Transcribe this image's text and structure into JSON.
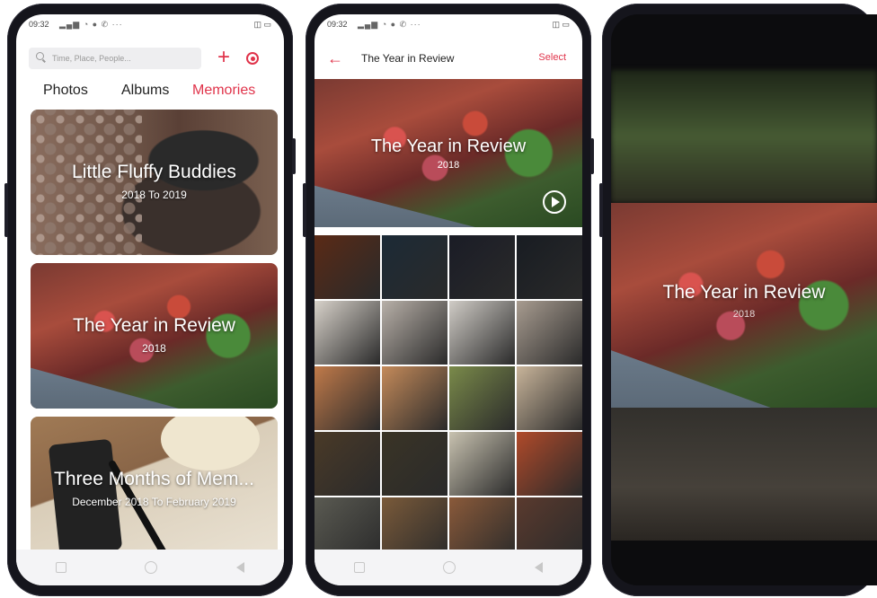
{
  "phone1": {
    "status": {
      "time": "09:32"
    },
    "search": {
      "placeholder": "Time, Place, People..."
    },
    "tabs": [
      "Photos",
      "Albums",
      "Memories"
    ],
    "memories": [
      {
        "title": "Little Fluffy Buddies",
        "subtitle": "2018 To 2019"
      },
      {
        "title": "The Year in Review",
        "subtitle": "2018"
      },
      {
        "title": "Three Months of Mem...",
        "subtitle": "December 2018 To February 2019"
      }
    ]
  },
  "phone2": {
    "status": {
      "time": "09:32"
    },
    "header": {
      "title": "The Year in Review",
      "select_label": "Select"
    },
    "hero": {
      "title": "The Year in Review",
      "subtitle": "2018"
    },
    "grid_colors": [
      "#5a2a16",
      "#1c2a36",
      "#1a1c26",
      "#181c22",
      "#d8d2ca",
      "#b8b0a8",
      "#d0ccc6",
      "#a89c90",
      "#c07a4a",
      "#c48a5a",
      "#7a8a4a",
      "#c8b49a",
      "#4a3a28",
      "#3a3426",
      "#c8c2b0",
      "#b04a2a",
      "#5a5a52",
      "#7a5a3a",
      "#8a5a3a",
      "#5a3a2e"
    ]
  },
  "phone3": {
    "title": "The Year in Review",
    "subtitle": "2018"
  },
  "colors": {
    "accent": "#e0334a"
  }
}
